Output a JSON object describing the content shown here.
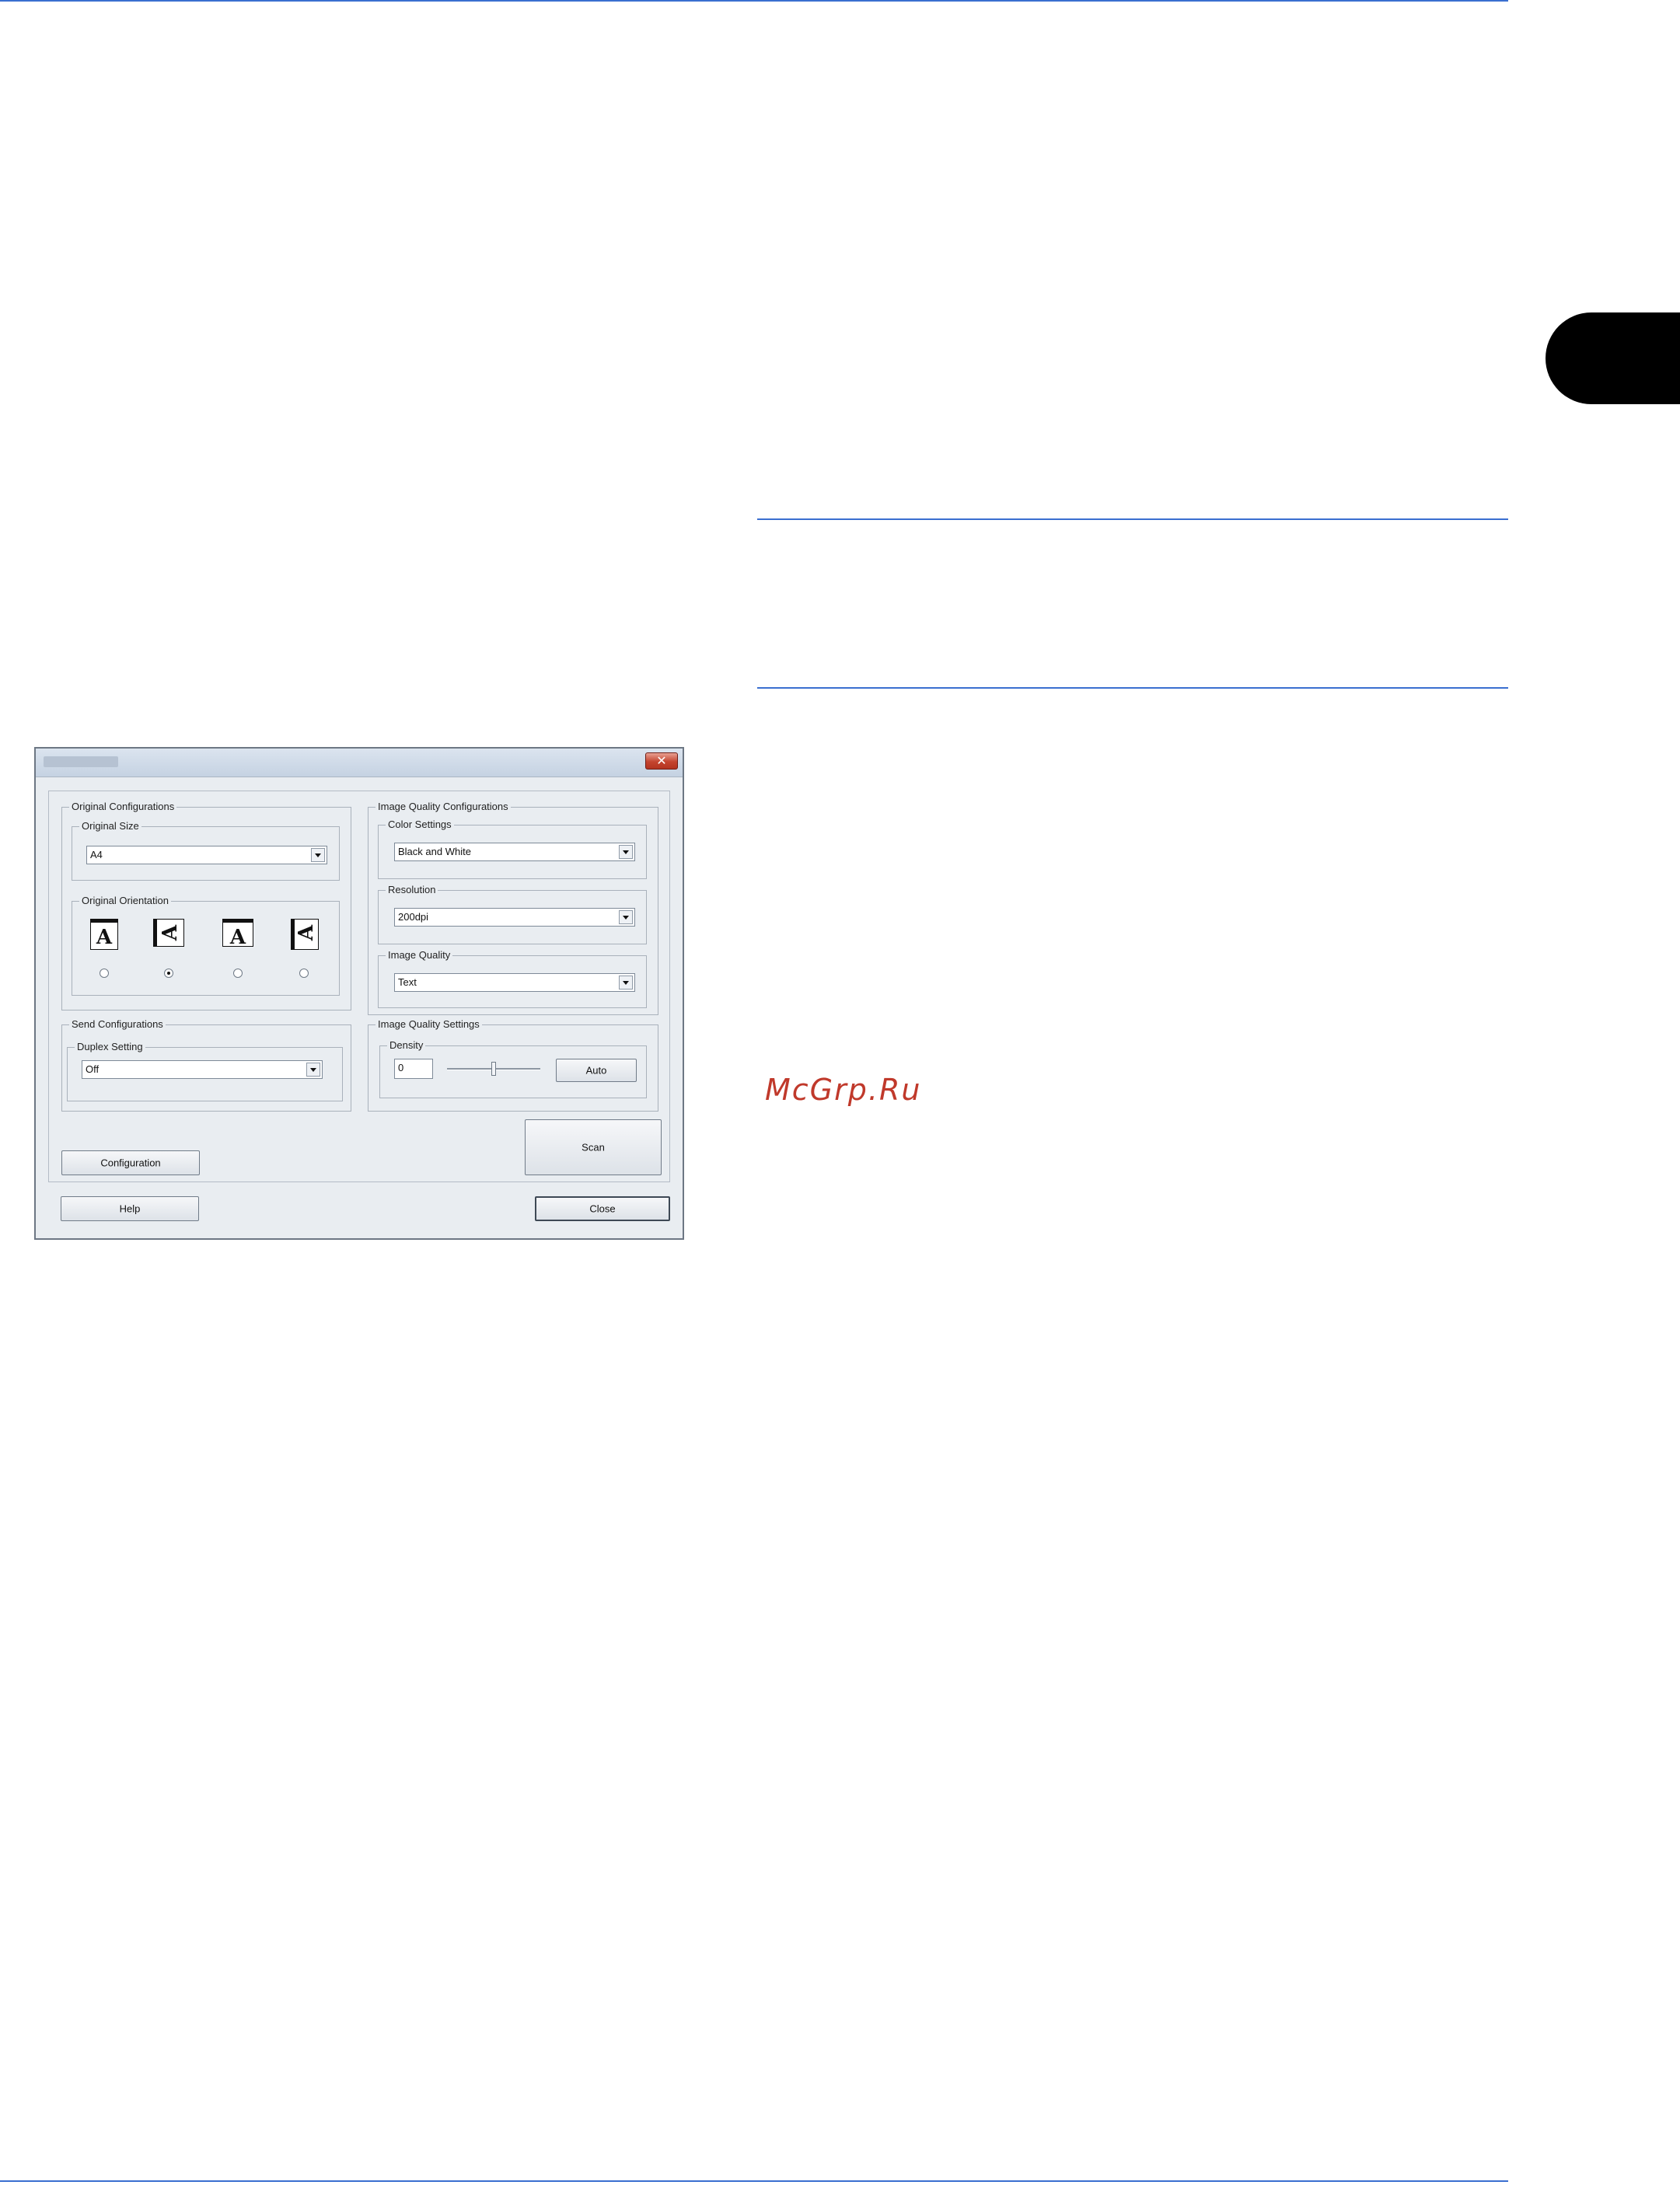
{
  "dialog": {
    "close_glyph": "✕",
    "original_configurations": {
      "label": "Original Configurations",
      "original_size": {
        "label": "Original Size",
        "value": "A4"
      },
      "original_orientation": {
        "label": "Original Orientation",
        "icon_glyph": "A",
        "options": [
          {
            "icon": "portrait-top-edge-icon",
            "checked": false
          },
          {
            "icon": "landscape-left-edge-icon",
            "checked": true
          },
          {
            "icon": "portrait-top-edge-icon",
            "checked": false
          },
          {
            "icon": "landscape-left-edge-icon",
            "checked": false
          }
        ]
      }
    },
    "send_configurations": {
      "label": "Send Configurations",
      "duplex_setting": {
        "label": "Duplex Setting",
        "value": "Off"
      }
    },
    "image_quality_configurations": {
      "label": "Image Quality Configurations",
      "color_settings": {
        "label": "Color Settings",
        "value": "Black and White"
      },
      "resolution": {
        "label": "Resolution",
        "value": "200dpi"
      },
      "image_quality": {
        "label": "Image Quality",
        "value": "Text"
      }
    },
    "image_quality_settings": {
      "label": "Image Quality Settings",
      "density": {
        "label": "Density",
        "value": "0",
        "auto_label": "Auto",
        "slider_level": 0.5
      }
    },
    "buttons": {
      "configuration": "Configuration",
      "scan": "Scan",
      "help": "Help",
      "close": "Close"
    }
  },
  "watermark": "McGrp.Ru",
  "colors": {
    "rule": "#3a6fd0",
    "side_tab": "#000000",
    "watermark": "#c0392b",
    "dialog_bg": "#e9edf1"
  }
}
